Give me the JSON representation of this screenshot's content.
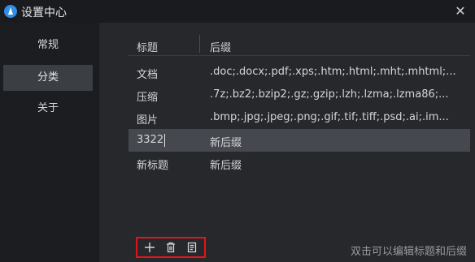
{
  "window": {
    "title": "设置中心",
    "close_glyph": "✕"
  },
  "sidebar": {
    "items": [
      {
        "label": "常规",
        "active": false
      },
      {
        "label": "分类",
        "active": true
      },
      {
        "label": "关于",
        "active": false
      }
    ]
  },
  "table": {
    "headers": {
      "title": "标题",
      "suffix": "后缀"
    },
    "rows": [
      {
        "title": "文档",
        "suffix": ".doc;.docx;.pdf;.xps;.htm;.html;.mht;.mhtml;..."
      },
      {
        "title": "压缩",
        "suffix": ".7z;.bz2;.bzip2;.gz;.gzip;.lzh;.lzma;.lzma86;..."
      },
      {
        "title": "图片",
        "suffix": ".bmp;.jpg;.jpeg;.png;.gif;.tif;.tiff;.psd;.ai;.im..."
      },
      {
        "title": "3322",
        "suffix": "新后缀",
        "selected": true,
        "editing": true
      },
      {
        "title": "新标题",
        "suffix": "新后缀"
      }
    ]
  },
  "toolbar": {
    "buttons": [
      {
        "name": "add",
        "icon": "plus-icon"
      },
      {
        "name": "delete",
        "icon": "trash-icon"
      },
      {
        "name": "edit",
        "icon": "document-icon"
      }
    ],
    "highlight_color": "#e0161c"
  },
  "footer": {
    "hint": "双击可以编辑标题和后缀"
  }
}
